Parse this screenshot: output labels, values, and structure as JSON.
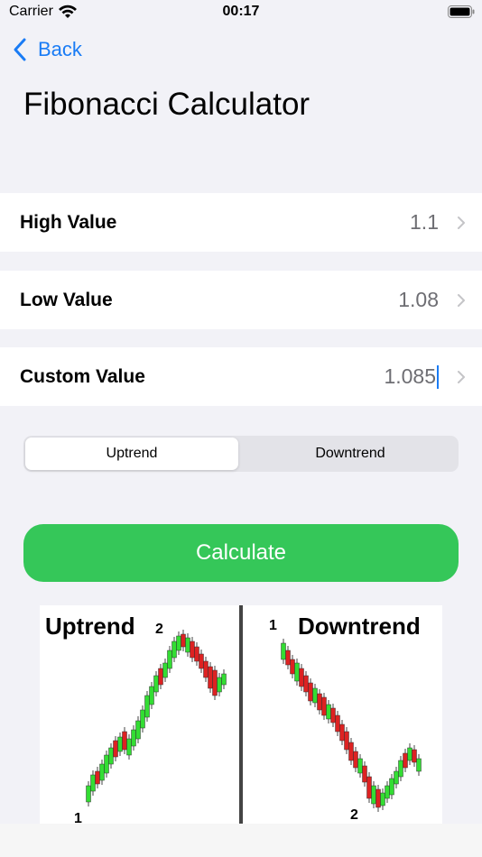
{
  "status": {
    "carrier": "Carrier",
    "time": "00:17"
  },
  "nav": {
    "back_label": "Back"
  },
  "page": {
    "title": "Fibonacci Calculator"
  },
  "fields": [
    {
      "label": "High Value",
      "value": "1.1"
    },
    {
      "label": "Low Value",
      "value": "1.08"
    },
    {
      "label": "Custom Value",
      "value": "1.085"
    }
  ],
  "trend_control": {
    "options": [
      "Uptrend",
      "Downtrend"
    ],
    "selected": "Uptrend"
  },
  "calculate_label": "Calculate",
  "illustration": {
    "uptrend_title": "Uptrend",
    "downtrend_title": "Downtrend",
    "up_point1": "1",
    "up_point2": "2",
    "down_point1": "1",
    "down_point2": "2"
  },
  "colors": {
    "accent": "#1a7cf5",
    "button_green": "#35c759",
    "bull": "#33dd33",
    "bear": "#dd2222"
  }
}
